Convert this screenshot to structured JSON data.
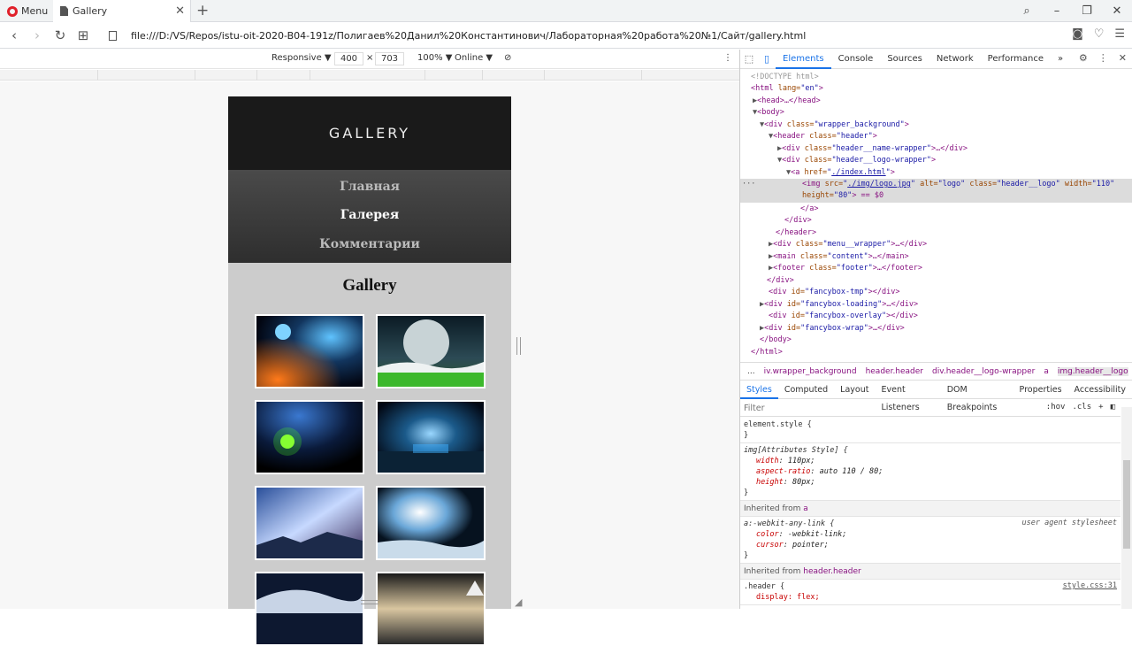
{
  "browser": {
    "menu_label": "Menu",
    "tab_title": "Gallery",
    "new_tab": "+",
    "url": "file:///D:/VS/Repos/istu-oit-2020-B04-191z/Полигаев%20Данил%20Константинович/Лабораторная%20работа%20№1/Сайт/gallery.html"
  },
  "device_toolbar": {
    "mode": "Responsive ▼",
    "width": "400",
    "times": "×",
    "height": "703",
    "zoom": "100% ▼",
    "network": "Online ▼"
  },
  "site": {
    "logo_text": "GALLERY",
    "menu": [
      {
        "label": "Главная",
        "active": false
      },
      {
        "label": "Галерея",
        "active": true
      },
      {
        "label": "Комментарии",
        "active": false
      }
    ],
    "title": "Gallery",
    "thumbnails": [
      "space-planet-blue",
      "moon-over-field",
      "earth-green-glow",
      "blue-planet-city",
      "nebula-landscape",
      "moon-ice-landscape",
      "cloud-sky",
      "sunset-mountain"
    ]
  },
  "devtools": {
    "tabs": [
      "Elements",
      "Console",
      "Sources",
      "Network",
      "Performance"
    ],
    "more": "»",
    "elements_lines": [
      {
        "indent": 12,
        "tri": "",
        "html": "doctype"
      },
      {
        "indent": 12,
        "tri": "",
        "html": "html"
      },
      {
        "indent": 16,
        "tri": "▶",
        "html": "head"
      },
      {
        "indent": 16,
        "tri": "▼",
        "html": "body"
      },
      {
        "indent": 24,
        "tri": "▼",
        "html": "wrapper"
      },
      {
        "indent": 34,
        "tri": "▼",
        "html": "header"
      },
      {
        "indent": 44,
        "tri": "▶",
        "html": "name-wrapper"
      },
      {
        "indent": 44,
        "tri": "▼",
        "html": "logo-wrapper"
      },
      {
        "indent": 54,
        "tri": "▼",
        "html": "a"
      },
      {
        "indent": 70,
        "tri": "",
        "html": "img1"
      },
      {
        "indent": 70,
        "tri": "",
        "html": "img2"
      },
      {
        "indent": 62,
        "tri": "",
        "html": "close-a"
      },
      {
        "indent": 50,
        "tri": "",
        "html": "close-div"
      },
      {
        "indent": 40,
        "tri": "",
        "html": "close-header"
      },
      {
        "indent": 34,
        "tri": "▶",
        "html": "menu-wrapper"
      },
      {
        "indent": 34,
        "tri": "▶",
        "html": "main"
      },
      {
        "indent": 34,
        "tri": "▶",
        "html": "footer"
      },
      {
        "indent": 30,
        "tri": "",
        "html": "close-div2"
      },
      {
        "indent": 24,
        "tri": "",
        "html": "fancybox-tmp"
      },
      {
        "indent": 24,
        "tri": "▶",
        "html": "fancybox-loading"
      },
      {
        "indent": 24,
        "tri": "",
        "html": "fancybox-overlay"
      },
      {
        "indent": 24,
        "tri": "▶",
        "html": "fancybox-wrap"
      },
      {
        "indent": 20,
        "tri": "",
        "html": "close-body"
      },
      {
        "indent": 12,
        "tri": "",
        "html": "close-html"
      }
    ],
    "text": {
      "doctype": "<!DOCTYPE html>",
      "html_open": "<html",
      "lang_attr": " lang=",
      "lang_val": "\"en\"",
      "close_bracket": ">",
      "head": "<head>…</head>",
      "body": "<body>",
      "div_open": "<div",
      "class_attr": " class=",
      "wrapper_val": "\"wrapper_background\"",
      "header_open": "<header",
      "header_val": "\"header\"",
      "name_wrapper_val": "\"header__name-wrapper\"",
      "logo_wrapper_val": "\"header__logo-wrapper\"",
      "ellipsis_div": ">…</div>",
      "a_open": "<a",
      "href_attr": " href=",
      "href_val": "./index.html",
      "img_open": "<img",
      "src_attr": " src=",
      "src_val": "./img/logo.jpg",
      "alt_attr": " alt=",
      "alt_val": "\"logo\"",
      "img_class_val": "\"header__logo\"",
      "width_attr": " width=",
      "width_val": "\"110\"",
      "height_attr": "height=",
      "height_val": "\"80\"",
      "eq_zero": "> == $0",
      "a_close": "</a>",
      "div_close": "</div>",
      "header_close": "</header>",
      "menu_wrapper_val": "\"menu__wrapper\"",
      "main_open": "<main",
      "content_val": "\"content\"",
      "main_tail": ">…</main>",
      "footer_open": "<footer",
      "footer_val": "\"footer\"",
      "footer_tail": ">…</footer>",
      "id_attr": " id=",
      "fancybox_tmp": "\"fancybox-tmp\"",
      "fancybox_loading": "\"fancybox-loading\"",
      "fancybox_overlay": "\"fancybox-overlay\"",
      "fancybox_wrap": "\"fancybox-wrap\"",
      "empty_div_close": "></div>",
      "body_close": "</body>",
      "html_close": "</html>",
      "quote": "\""
    },
    "breadcrumb": [
      "...",
      "iv.wrapper_background",
      "header.header",
      "div.header__logo-wrapper",
      "a",
      "img.header__logo"
    ],
    "sub_tabs": [
      "Styles",
      "Computed",
      "Layout",
      "Event Listeners",
      "DOM Breakpoints",
      "Properties",
      "Accessibility"
    ],
    "filter_placeholder": "Filter",
    "filter_hov": ":hov",
    "filter_cls": ".cls",
    "filter_plus": "+",
    "styles": {
      "element_style": "element.style {",
      "close": "}",
      "img_attr_selector": "img[Attributes Style] {",
      "img_props": [
        {
          "name": "width",
          "value": "110px;"
        },
        {
          "name": "aspect-ratio",
          "value": "auto 110 / 80;"
        },
        {
          "name": "height",
          "value": "80px;"
        }
      ],
      "inherited_a_label": "Inherited from",
      "inherited_a_tag": "a",
      "anylink_selector": "a:-webkit-any-link {",
      "anylink_origin": "user agent stylesheet",
      "anylink_props": [
        {
          "name": "color",
          "value": "-webkit-link;"
        },
        {
          "name": "cursor",
          "value": "pointer;"
        }
      ],
      "inherited_header_label": "Inherited from",
      "inherited_header_tag": "header.header",
      "header_selector": ".header {",
      "header_origin": "style.css:31",
      "header_cut": "display: flex;"
    }
  }
}
